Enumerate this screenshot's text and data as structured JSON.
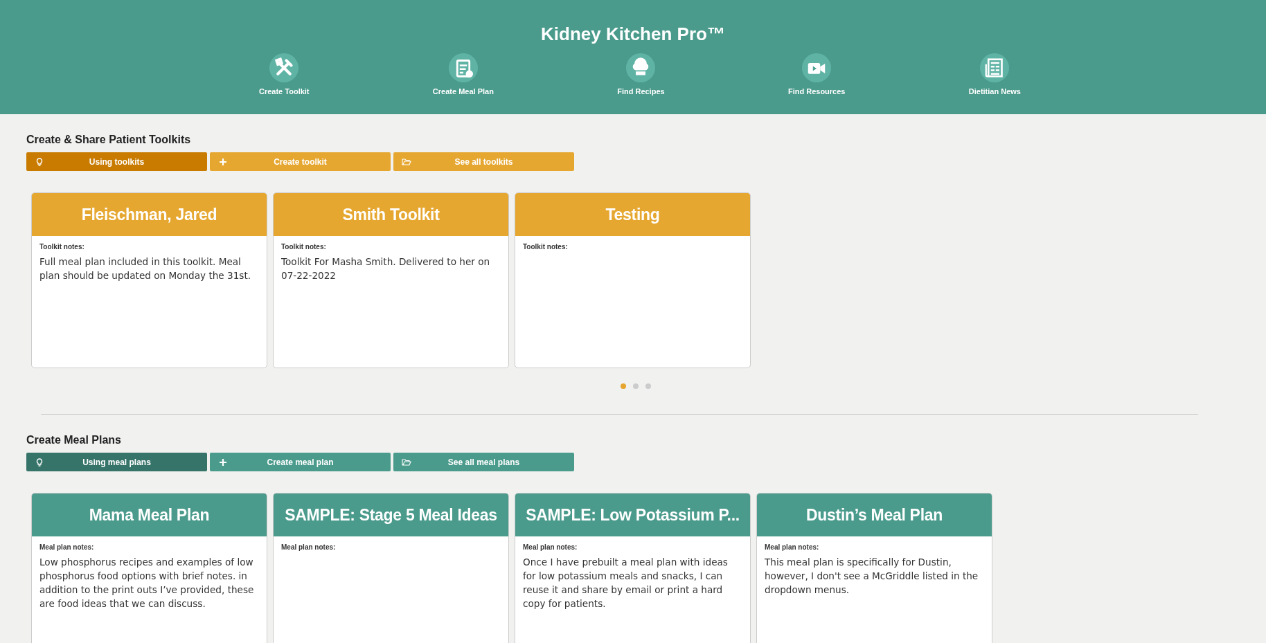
{
  "header": {
    "title": "Kidney Kitchen Pro™",
    "nav": [
      {
        "label": "Create Toolkit",
        "kind": "tools"
      },
      {
        "label": "Create Meal Plan",
        "kind": "clipboard"
      },
      {
        "label": "Find Recipes",
        "kind": "chef"
      },
      {
        "label": "Find Resources",
        "kind": "video"
      },
      {
        "label": "Dietitian News",
        "kind": "news"
      }
    ]
  },
  "sections": [
    {
      "heading": "Create & Share Patient Toolkits",
      "color": "#e6a730",
      "buttons": [
        {
          "label": "Using toolkits",
          "kind": "info",
          "color": "#c97b00"
        },
        {
          "label": "Create toolkit",
          "kind": "create",
          "color": "#e6a730"
        },
        {
          "label": "See all toolkits",
          "kind": "browse",
          "color": "#e6a730"
        }
      ],
      "cards": [
        {
          "title": "Fleischman, Jared",
          "notes_label": "Toolkit notes:",
          "notes": "Full meal plan included in this toolkit. Meal plan should be updated on Monday the 31st."
        },
        {
          "title": "Smith Toolkit",
          "notes_label": "Toolkit notes:",
          "notes": "Toolkit For Masha Smith. Delivered to her on 07-22-2022"
        },
        {
          "title": "Testing",
          "notes_label": "Toolkit notes:"
        }
      ],
      "pager": [
        {
          "selected": true
        },
        {
          "selected": false
        },
        {
          "selected": false
        }
      ]
    },
    {
      "heading": "Create Meal Plans",
      "color": "#4a9b8c",
      "buttons": [
        {
          "label": "Using meal plans",
          "kind": "info",
          "color": "#36746a"
        },
        {
          "label": "Create meal plan",
          "kind": "create",
          "color": "#4a9b8c"
        },
        {
          "label": "See all meal plans",
          "kind": "browse",
          "color": "#4a9b8c"
        }
      ],
      "cards": [
        {
          "title": "Mama Meal Plan",
          "notes_label": "Meal plan notes:",
          "notes": "Low phosphorus recipes and examples of low phosphorus food options with brief notes. in addition to the print outs I’ve provided, these are food ideas that we can discuss."
        },
        {
          "title": "SAMPLE: Stage 5 Meal Ideas",
          "notes_label": "Meal plan notes:"
        },
        {
          "title": "SAMPLE: Low Potassium P...",
          "notes_label": "Meal plan notes:",
          "notes": "Once I have prebuilt a meal plan with ideas for low potassium meals and snacks, I can reuse it and share by email or print a hard copy for patients."
        },
        {
          "title": "Dustin’s Meal Plan",
          "notes_label": "Meal plan notes:",
          "notes": "This meal plan is specifically for Dustin, however, I don't see a McGriddle listed in the dropdown menus."
        }
      ]
    }
  ]
}
